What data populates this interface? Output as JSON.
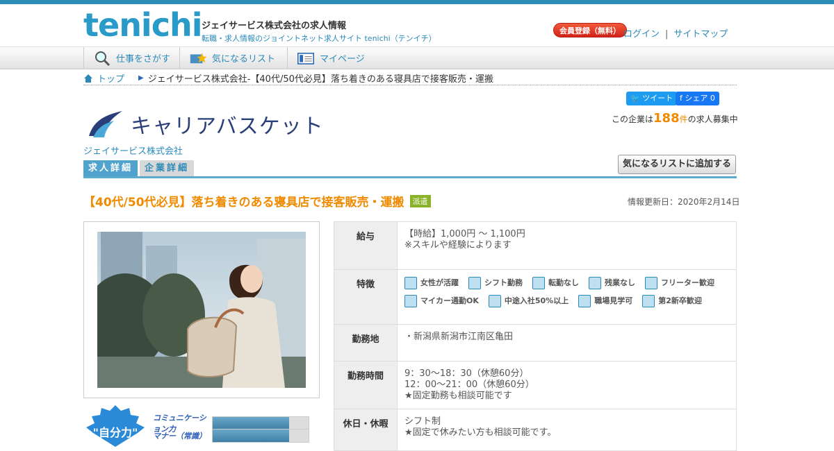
{
  "header": {
    "logo": "tenichi",
    "title": "ジェイサービス株式会社の求人情報",
    "subtitle": "転職・求人情報のジョイントネット求人サイト tenichi（テンイチ）",
    "register": "会員登録（無料）",
    "login": "ログイン",
    "separator": "|",
    "sitemap": "サイトマップ"
  },
  "nav": [
    {
      "label": "仕事をさがす",
      "icon": "search-icon"
    },
    {
      "label": "気になるリスト",
      "icon": "folder-star-icon"
    },
    {
      "label": "マイページ",
      "icon": "card-icon"
    }
  ],
  "breadcrumb": {
    "home": "トップ",
    "current": "ジェイサービス株式会社-【40代/50代必見】落ち着きのある寝具店で接客販売・運搬"
  },
  "social": {
    "tweet": "ツイート",
    "share": "シェア 0"
  },
  "company": {
    "logo_text": "キャリアバスケット",
    "name": "ジェイサービス株式会社",
    "count_prefix": "この企業は",
    "count": "188",
    "count_unit": "件",
    "count_suffix": "の求人募集中"
  },
  "tabs": [
    "求人詳細",
    "企業詳細"
  ],
  "add_button": "気になるリストに追加する",
  "job": {
    "title": "【40代/50代必見】落ち着きのある寝具店で接客販売・運搬",
    "badge": "派遣",
    "updated": "情報更新日：2020年2月14日"
  },
  "skills": {
    "badge": "\"自分力\"",
    "rows": [
      {
        "label": "コミュニケーション力",
        "fill": 0.8
      },
      {
        "label": "マナー（常識）",
        "fill": 0.8
      }
    ]
  },
  "details": {
    "salary_label": "給与",
    "salary_line1": "【時給】1,000円 ～ 1,100円",
    "salary_line2": "※スキルや経験によります",
    "features_label": "特徴",
    "features": [
      "女性が活躍",
      "シフト勤務",
      "転勤なし",
      "残業なし",
      "フリーター歓迎",
      "マイカー通勤OK",
      "中途入社50%以上",
      "職場見学可",
      "第2新卒歓迎"
    ],
    "location_label": "勤務地",
    "location": "・新潟県新潟市江南区亀田",
    "hours_label": "勤務時間",
    "hours_line1": "9：30～18：30（休憩60分）",
    "hours_line2": "12：00～21：00（休憩60分）",
    "hours_line3": "★固定勤務も相談可能です",
    "holiday_label": "休日・休暇",
    "holiday_line1": "シフト制",
    "holiday_line2": "★固定で休みたい方も相談可能です。"
  }
}
